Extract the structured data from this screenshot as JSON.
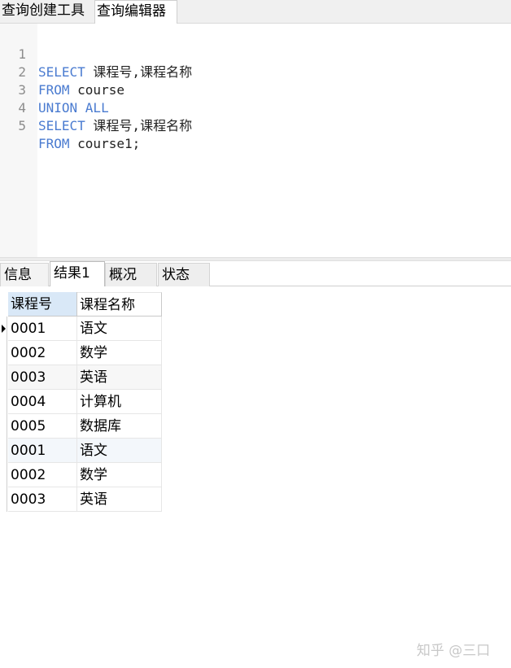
{
  "top_tabs": [
    "查询创建工具",
    "查询编辑器"
  ],
  "editor": {
    "lines": [
      {
        "num": "1",
        "keyword": "SELECT",
        "rest": " 课程号,课程名称"
      },
      {
        "num": "2",
        "keyword": "FROM",
        "rest": " course"
      },
      {
        "num": "3",
        "keyword": "UNION ALL",
        "rest": ""
      },
      {
        "num": "4",
        "keyword": "SELECT",
        "rest": " 课程号,课程名称"
      },
      {
        "num": "5",
        "keyword": "FROM",
        "rest": " course1;"
      }
    ]
  },
  "result_tabs": [
    "信息",
    "结果1",
    "概况",
    "状态"
  ],
  "grid": {
    "columns": [
      "课程号",
      "课程名称"
    ],
    "rows": [
      [
        "0001",
        "语文"
      ],
      [
        "0002",
        "数学"
      ],
      [
        "0003",
        "英语"
      ],
      [
        "0004",
        "计算机"
      ],
      [
        "0005",
        "数据库"
      ],
      [
        "0001",
        "语文"
      ],
      [
        "0002",
        "数学"
      ],
      [
        "0003",
        "英语"
      ]
    ]
  },
  "watermark": "知乎 @三口",
  "colors": {
    "keyword": "#4a7bd0",
    "header_selected": "#d9e8f7"
  }
}
